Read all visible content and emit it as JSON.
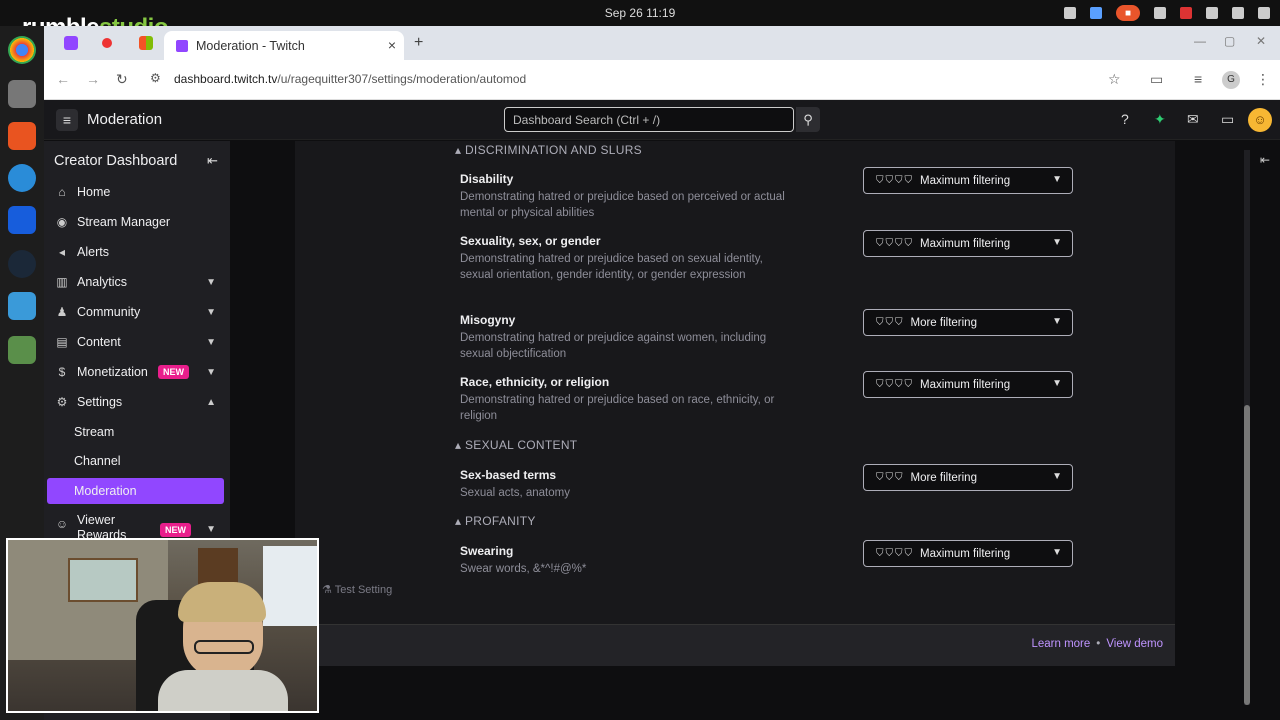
{
  "os": {
    "clock": "Sep 26  11:19",
    "brand_left": "rumble",
    "brand_right": "studio"
  },
  "browser": {
    "tab_title": "Moderation - Twitch",
    "tab_close": "×",
    "new_tab": "+",
    "url_host": "dashboard.twitch.tv",
    "url_path": "/u/ragequitter307/settings/moderation/automod",
    "profile_letter": "G"
  },
  "twitch_header": {
    "title": "Moderation",
    "search_placeholder": "Dashboard Search (Ctrl + /)"
  },
  "sidebar": {
    "title": "Creator Dashboard",
    "items": [
      {
        "label": "Home",
        "icon": "home-icon"
      },
      {
        "label": "Stream Manager",
        "icon": "stream-manager-icon"
      },
      {
        "label": "Alerts",
        "icon": "megaphone-icon"
      },
      {
        "label": "Analytics",
        "icon": "chart-icon"
      },
      {
        "label": "Community",
        "icon": "community-icon"
      },
      {
        "label": "Content",
        "icon": "content-icon"
      },
      {
        "label": "Monetization",
        "icon": "dollar-icon",
        "badge": "NEW"
      },
      {
        "label": "Settings",
        "icon": "gear-icon"
      }
    ],
    "settings_sub": [
      "Stream",
      "Channel",
      "Moderation"
    ],
    "viewer_rewards": {
      "label": "Viewer Rewards",
      "badge": "NEW"
    }
  },
  "automod": {
    "sections": [
      {
        "title": "DISCRIMINATION AND SLURS"
      },
      {
        "title": "SEXUAL CONTENT"
      },
      {
        "title": "PROFANITY"
      }
    ],
    "rules": [
      {
        "title": "Disability",
        "desc": "Demonstrating hatred or prejudice based on perceived or actual mental or physical abilities",
        "level": "Maximum filtering",
        "shields": 4
      },
      {
        "title": "Sexuality, sex, or gender",
        "desc": "Demonstrating hatred or prejudice based on sexual identity, sexual orientation, gender identity, or gender expression",
        "level": "Maximum filtering",
        "shields": 4
      },
      {
        "title": "Misogyny",
        "desc": "Demonstrating hatred or prejudice against women, including sexual objectification",
        "level": "More filtering",
        "shields": 3
      },
      {
        "title": "Race, ethnicity, or religion",
        "desc": "Demonstrating hatred or prejudice based on race, ethnicity, or religion",
        "level": "Maximum filtering",
        "shields": 4
      },
      {
        "title": "Sex-based terms",
        "desc": "Sexual acts, anatomy",
        "level": "More filtering",
        "shields": 3
      },
      {
        "title": "Swearing",
        "desc": "Swear words, &*^!#@%*",
        "level": "Maximum filtering",
        "shields": 4
      }
    ],
    "test_setting": "Test Setting",
    "footer": {
      "learn_more": "Learn more",
      "view_demo": "View demo"
    }
  }
}
